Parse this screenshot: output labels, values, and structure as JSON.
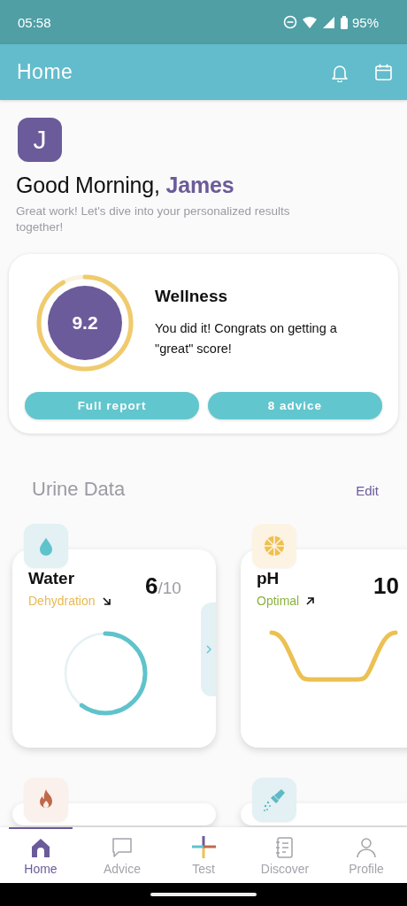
{
  "status_bar": {
    "time": "05:58",
    "battery": "95%"
  },
  "app_bar": {
    "title": "Home"
  },
  "greeting": {
    "avatar_letter": "J",
    "text": "Good Morning, **James**",
    "subtitle": "Great work! Let's dive into your personalized results together!"
  },
  "wellness": {
    "score": "9.2",
    "title": "Wellness",
    "message": "You did it! Congrats on getting a \"great\" score!",
    "buttons": [
      "Full report",
      "8 advice"
    ]
  },
  "urine_data": {
    "title": "Urine Data",
    "edit": "Edit",
    "cards": [
      {
        "kind": "ring",
        "title": "Water",
        "status": "Dehydration",
        "color": "#e8b94f",
        "trend_up": false,
        "score": "6",
        "max": "/10",
        "level": 0.6,
        "expand": true
      },
      {
        "kind": "curve",
        "title": "pH",
        "status": "Optimal",
        "color": "#8ab33f",
        "trend_up": true,
        "score": "10",
        "expand": false
      },
      {
        "kind": "partial"
      },
      {
        "kind": "partial"
      }
    ]
  },
  "nav": [
    {
      "label": "Home",
      "selected": true
    },
    {
      "label": "Advice",
      "selected": false
    },
    {
      "label": "Test",
      "selected": false
    },
    {
      "label": "Discover",
      "selected": false
    },
    {
      "label": "Profile",
      "selected": false
    }
  ]
}
